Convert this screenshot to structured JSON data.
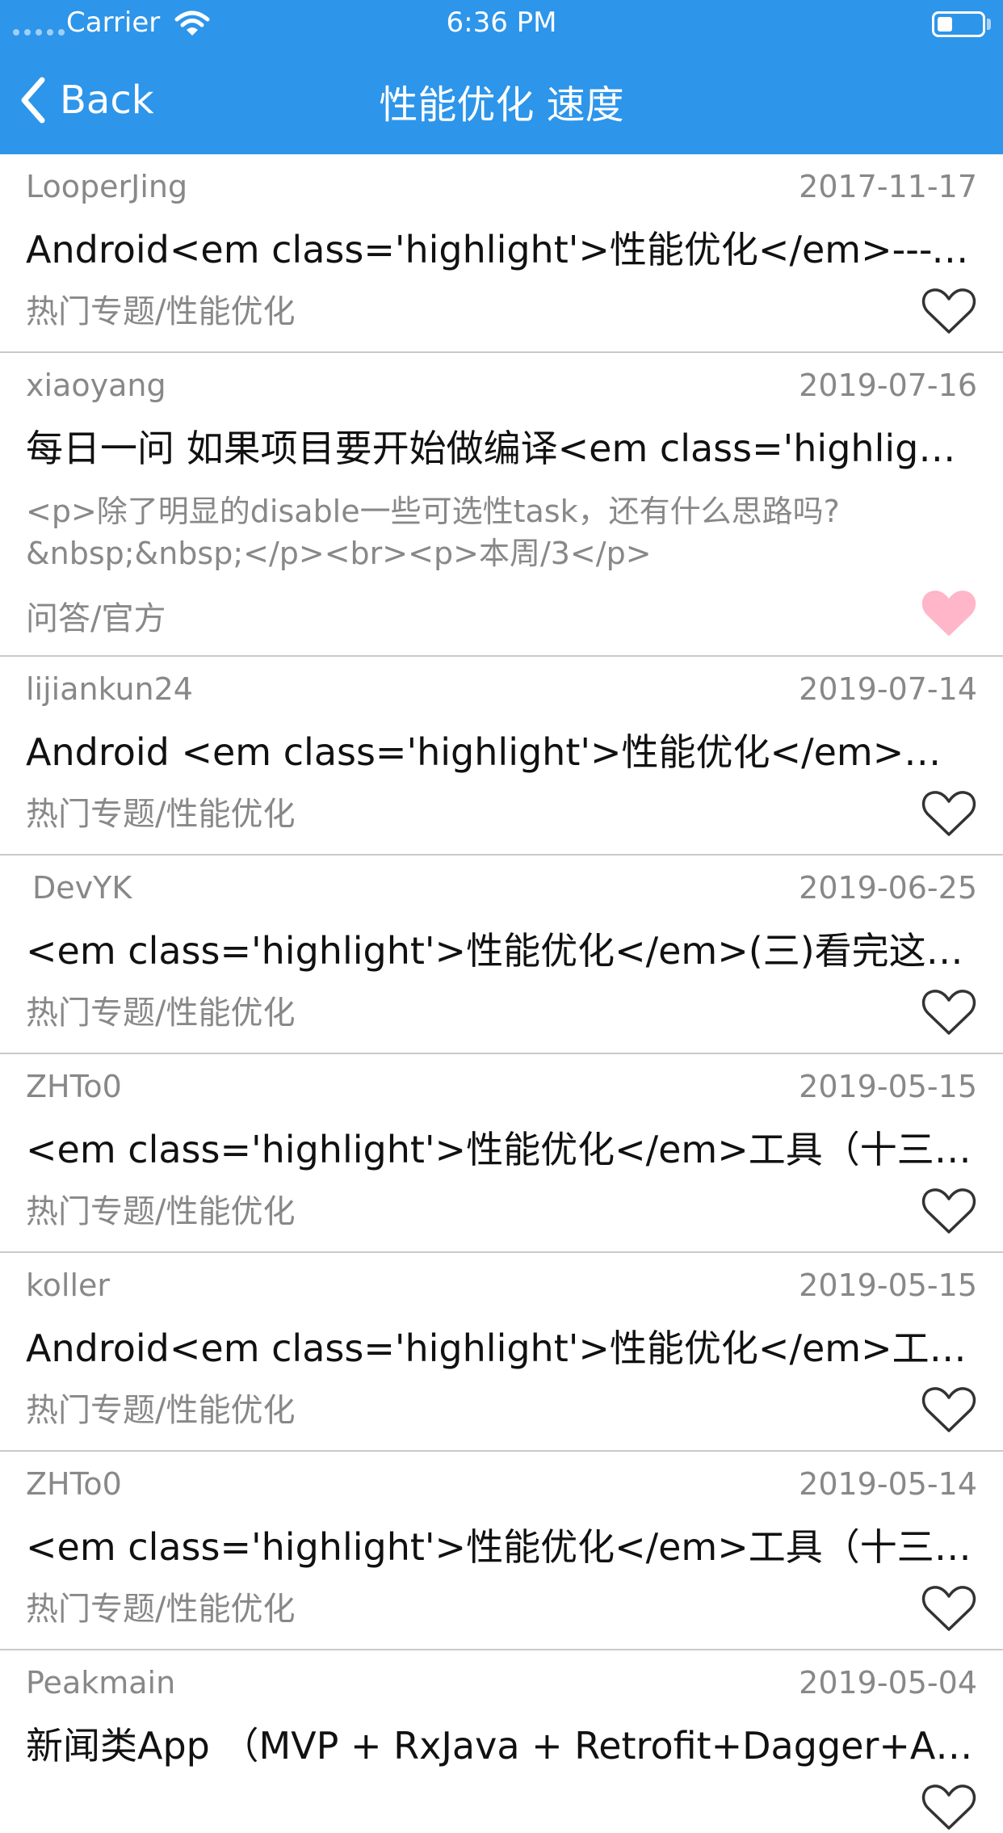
{
  "status_bar": {
    "carrier": "Carrier",
    "time": "6:36 PM",
    "icons": [
      "signal-dots-icon",
      "wifi-icon",
      "battery-icon"
    ]
  },
  "nav": {
    "back_label": "Back",
    "back_icon": "chevron-left-icon",
    "title": "性能优化 速度",
    "background": "#2d95ea"
  },
  "articles": [
    {
      "author": "LooperJing",
      "date": "2017-11-17",
      "title": "Android<em class='highlight'>性能优化</em>---Ap…",
      "category": "热门专题/性能优化",
      "favorited": false
    },
    {
      "author": "xiaoyang",
      "date": "2019-07-16",
      "title": "每日一问 如果项目要开始做编译<em class='highligh…",
      "desc_line1": "<p>除了明显的disable一些可选性task，还有什么思路吗?",
      "desc_line2": "&nbsp;&nbsp;</p><br><p>本周/3</p>",
      "category": "问答/官方",
      "favorited": true
    },
    {
      "author": "lijiankun24",
      "date": "2019-07-14",
      "title": "Android <em class='highlight'>性能优化</em>系列…",
      "category": "热门专题/性能优化",
      "favorited": false
    },
    {
      "author": "DevYK",
      "date": "2019-06-25",
      "title": "<em class='highlight'>性能优化</em>(三)看完这篇…",
      "category": "热门专题/性能优化",
      "favorited": false
    },
    {
      "author": "ZHTo0",
      "date": "2019-05-15",
      "title": "<em class='highlight'>性能优化</em>工具（十三）…",
      "category": "热门专题/性能优化",
      "favorited": false
    },
    {
      "author": "koller",
      "date": "2019-05-15",
      "title": "Android<em class='highlight'>性能优化</em>工具…",
      "category": "热门专题/性能优化",
      "favorited": false
    },
    {
      "author": "ZHTo0",
      "date": "2019-05-14",
      "title": "<em class='highlight'>性能优化</em>工具（十三）…",
      "category": "热门专题/性能优化",
      "favorited": false
    },
    {
      "author": "Peakmain",
      "date": "2019-05-04",
      "title": "新闻类App （MVP + RxJava + Retrofit+Dagger+ARo…",
      "favorited": false
    }
  ],
  "colors": {
    "favorite_on": "#ffb6c8",
    "favorite_off": "#333333",
    "meta_text": "#888888"
  }
}
